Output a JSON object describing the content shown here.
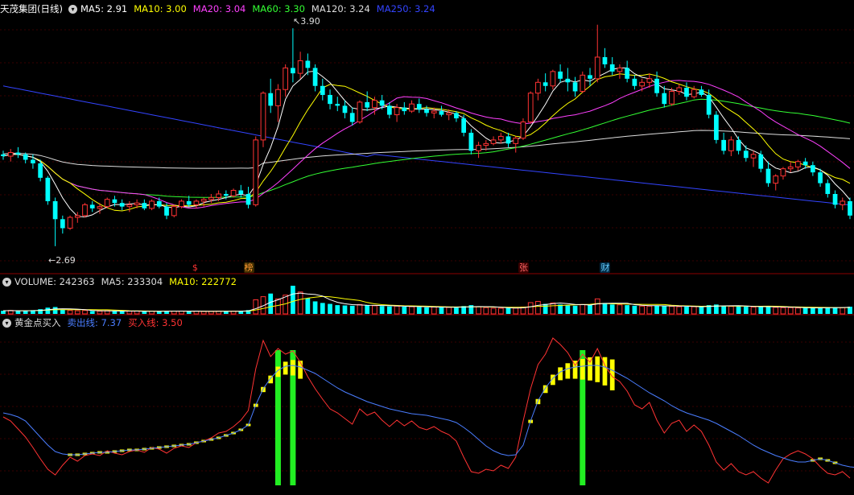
{
  "price_panel": {
    "stock_name": "天茂集团(日线)",
    "legend": [
      {
        "label": "MA5: 2.91",
        "color": "#ffffff"
      },
      {
        "label": "MA10: 3.00",
        "color": "#ffff00"
      },
      {
        "label": "MA20: 3.04",
        "color": "#ff40ff"
      },
      {
        "label": "MA60: 3.30",
        "color": "#33ff33"
      },
      {
        "label": "MA120: 3.24",
        "color": "#dddddd"
      },
      {
        "label": "MA250: 3.24",
        "color": "#3344ff"
      }
    ],
    "high_label": "3.90",
    "low_label": "2.69",
    "event_badges": [
      {
        "text": "$",
        "color": "#ff3333",
        "bg": "#000000"
      },
      {
        "text": "榜",
        "color": "#ff9933",
        "bg": "#3a2a00"
      },
      {
        "text": "张",
        "color": "#ff6666",
        "bg": "#3a0000"
      },
      {
        "text": "财",
        "color": "#66ccff",
        "bg": "#002a44"
      }
    ]
  },
  "volume_panel": {
    "legend": [
      {
        "label": "VOLUME: 242363",
        "color": "#dddddd"
      },
      {
        "label": "MA5: 233304",
        "color": "#dddddd"
      },
      {
        "label": "MA10: 222772",
        "color": "#ffff00"
      }
    ]
  },
  "indicator_panel": {
    "legend": [
      {
        "label": "黄金点买入",
        "color": "#dddddd"
      },
      {
        "label": "卖出线: 7.37",
        "color": "#4a7dff"
      },
      {
        "label": "买入线: 3.50",
        "color": "#ff3333"
      }
    ]
  },
  "chart_data": {
    "type": "candlestick",
    "price_range": [
      2.6,
      3.95
    ],
    "colors": {
      "up": "#ff3333",
      "down": "#00ffff",
      "ma5": "#ffffff",
      "ma10": "#ffff00",
      "ma20": "#ff40ff",
      "ma60": "#33ff33",
      "ma120": "#dddddd",
      "ma250": "#3344ff",
      "sell_line": "#4a7dff",
      "buy_line": "#ff3333",
      "yellow_bar": "#ffff00",
      "green_signal": "#22ee22"
    },
    "candles": [
      [
        3.2,
        3.22,
        3.17,
        3.19
      ],
      [
        3.19,
        3.23,
        3.16,
        3.21
      ],
      [
        3.21,
        3.24,
        3.18,
        3.2
      ],
      [
        3.2,
        3.21,
        3.15,
        3.17
      ],
      [
        3.17,
        3.2,
        3.12,
        3.15
      ],
      [
        3.15,
        3.17,
        3.05,
        3.07
      ],
      [
        3.07,
        3.08,
        2.92,
        2.94
      ],
      [
        2.94,
        2.96,
        2.69,
        2.84
      ],
      [
        2.84,
        2.86,
        2.76,
        2.79
      ],
      [
        2.79,
        2.86,
        2.78,
        2.85
      ],
      [
        2.85,
        2.88,
        2.82,
        2.86
      ],
      [
        2.86,
        2.93,
        2.85,
        2.92
      ],
      [
        2.92,
        2.94,
        2.88,
        2.9
      ],
      [
        2.9,
        2.93,
        2.87,
        2.91
      ],
      [
        2.91,
        2.96,
        2.9,
        2.95
      ],
      [
        2.95,
        2.97,
        2.91,
        2.93
      ],
      [
        2.93,
        2.95,
        2.89,
        2.91
      ],
      [
        2.91,
        2.94,
        2.88,
        2.92
      ],
      [
        2.92,
        2.95,
        2.9,
        2.93
      ],
      [
        2.93,
        2.95,
        2.89,
        2.9
      ],
      [
        2.9,
        2.95,
        2.89,
        2.94
      ],
      [
        2.94,
        2.96,
        2.9,
        2.91
      ],
      [
        2.91,
        2.93,
        2.84,
        2.86
      ],
      [
        2.86,
        2.92,
        2.85,
        2.91
      ],
      [
        2.91,
        2.95,
        2.9,
        2.94
      ],
      [
        2.94,
        2.97,
        2.91,
        2.92
      ],
      [
        2.92,
        2.95,
        2.9,
        2.94
      ],
      [
        2.94,
        2.96,
        2.91,
        2.95
      ],
      [
        2.95,
        2.98,
        2.93,
        2.96
      ],
      [
        2.96,
        3.0,
        2.94,
        2.98
      ],
      [
        2.98,
        3.0,
        2.95,
        2.97
      ],
      [
        2.97,
        3.01,
        2.96,
        3.0
      ],
      [
        3.0,
        3.03,
        2.96,
        2.98
      ],
      [
        2.98,
        3.02,
        2.9,
        2.92
      ],
      [
        2.92,
        3.3,
        2.91,
        3.28
      ],
      [
        3.28,
        3.55,
        3.24,
        3.54
      ],
      [
        3.54,
        3.62,
        3.43,
        3.47
      ],
      [
        3.47,
        3.59,
        3.38,
        3.56
      ],
      [
        3.56,
        3.7,
        3.52,
        3.68
      ],
      [
        3.68,
        3.9,
        3.6,
        3.65
      ],
      [
        3.65,
        3.77,
        3.62,
        3.72
      ],
      [
        3.72,
        3.76,
        3.64,
        3.68
      ],
      [
        3.68,
        3.7,
        3.55,
        3.58
      ],
      [
        3.58,
        3.62,
        3.5,
        3.53
      ],
      [
        3.53,
        3.56,
        3.45,
        3.48
      ],
      [
        3.48,
        3.52,
        3.44,
        3.47
      ],
      [
        3.47,
        3.5,
        3.4,
        3.43
      ],
      [
        3.43,
        3.46,
        3.36,
        3.38
      ],
      [
        3.38,
        3.5,
        3.37,
        3.49
      ],
      [
        3.49,
        3.55,
        3.44,
        3.46
      ],
      [
        3.46,
        3.52,
        3.42,
        3.5
      ],
      [
        3.5,
        3.53,
        3.45,
        3.47
      ],
      [
        3.47,
        3.49,
        3.4,
        3.42
      ],
      [
        3.42,
        3.48,
        3.38,
        3.46
      ],
      [
        3.46,
        3.49,
        3.42,
        3.44
      ],
      [
        3.44,
        3.5,
        3.43,
        3.48
      ],
      [
        3.48,
        3.51,
        3.43,
        3.45
      ],
      [
        3.45,
        3.47,
        3.41,
        3.43
      ],
      [
        3.43,
        3.46,
        3.4,
        3.44
      ],
      [
        3.44,
        3.47,
        3.41,
        3.42
      ],
      [
        3.42,
        3.45,
        3.39,
        3.43
      ],
      [
        3.43,
        3.44,
        3.38,
        3.4
      ],
      [
        3.4,
        3.42,
        3.3,
        3.32
      ],
      [
        3.32,
        3.34,
        3.2,
        3.22
      ],
      [
        3.22,
        3.27,
        3.18,
        3.25
      ],
      [
        3.25,
        3.28,
        3.22,
        3.26
      ],
      [
        3.26,
        3.3,
        3.25,
        3.28
      ],
      [
        3.28,
        3.32,
        3.26,
        3.3
      ],
      [
        3.3,
        3.32,
        3.24,
        3.26
      ],
      [
        3.26,
        3.3,
        3.21,
        3.29
      ],
      [
        3.29,
        3.4,
        3.28,
        3.38
      ],
      [
        3.38,
        3.55,
        3.37,
        3.54
      ],
      [
        3.54,
        3.62,
        3.5,
        3.6
      ],
      [
        3.6,
        3.65,
        3.55,
        3.58
      ],
      [
        3.58,
        3.67,
        3.56,
        3.66
      ],
      [
        3.66,
        3.7,
        3.6,
        3.62
      ],
      [
        3.62,
        3.68,
        3.55,
        3.6
      ],
      [
        3.6,
        3.63,
        3.52,
        3.55
      ],
      [
        3.55,
        3.66,
        3.54,
        3.64
      ],
      [
        3.64,
        3.68,
        3.58,
        3.62
      ],
      [
        3.62,
        3.92,
        3.6,
        3.74
      ],
      [
        3.74,
        3.79,
        3.68,
        3.7
      ],
      [
        3.7,
        3.74,
        3.64,
        3.66
      ],
      [
        3.66,
        3.7,
        3.62,
        3.68
      ],
      [
        3.68,
        3.72,
        3.6,
        3.62
      ],
      [
        3.62,
        3.64,
        3.56,
        3.58
      ],
      [
        3.58,
        3.62,
        3.55,
        3.6
      ],
      [
        3.6,
        3.65,
        3.57,
        3.62
      ],
      [
        3.62,
        3.66,
        3.52,
        3.54
      ],
      [
        3.54,
        3.58,
        3.46,
        3.48
      ],
      [
        3.48,
        3.57,
        3.47,
        3.55
      ],
      [
        3.55,
        3.59,
        3.53,
        3.57
      ],
      [
        3.57,
        3.6,
        3.5,
        3.52
      ],
      [
        3.52,
        3.58,
        3.51,
        3.56
      ],
      [
        3.56,
        3.58,
        3.52,
        3.53
      ],
      [
        3.53,
        3.56,
        3.4,
        3.42
      ],
      [
        3.42,
        3.44,
        3.26,
        3.28
      ],
      [
        3.28,
        3.32,
        3.2,
        3.22
      ],
      [
        3.22,
        3.3,
        3.19,
        3.28
      ],
      [
        3.28,
        3.3,
        3.2,
        3.22
      ],
      [
        3.22,
        3.25,
        3.16,
        3.18
      ],
      [
        3.18,
        3.22,
        3.13,
        3.2
      ],
      [
        3.2,
        3.22,
        3.1,
        3.12
      ],
      [
        3.12,
        3.16,
        3.02,
        3.04
      ],
      [
        3.04,
        3.09,
        3.0,
        3.08
      ],
      [
        3.08,
        3.13,
        3.06,
        3.12
      ],
      [
        3.12,
        3.16,
        3.1,
        3.13
      ],
      [
        3.13,
        3.17,
        3.11,
        3.16
      ],
      [
        3.16,
        3.18,
        3.12,
        3.14
      ],
      [
        3.14,
        3.16,
        3.08,
        3.1
      ],
      [
        3.1,
        3.12,
        3.02,
        3.04
      ],
      [
        3.04,
        3.06,
        2.96,
        2.98
      ],
      [
        2.98,
        3.0,
        2.9,
        2.92
      ],
      [
        2.92,
        2.96,
        2.89,
        2.94
      ],
      [
        2.94,
        2.96,
        2.84,
        2.86
      ]
    ],
    "volume": [
      1.0,
      1.1,
      0.9,
      1.0,
      1.2,
      1.5,
      2.0,
      2.2,
      1.3,
      1.1,
      1.0,
      1.1,
      0.9,
      0.9,
      1.0,
      0.9,
      0.8,
      0.9,
      0.9,
      0.8,
      0.9,
      0.8,
      1.0,
      0.9,
      0.9,
      0.8,
      0.9,
      0.8,
      0.8,
      0.9,
      0.9,
      0.9,
      0.9,
      1.2,
      4.5,
      5.5,
      6.5,
      4.8,
      6.0,
      9.0,
      7.0,
      5.0,
      4.0,
      3.5,
      3.2,
      2.8,
      2.7,
      2.6,
      3.0,
      2.7,
      2.6,
      2.5,
      2.4,
      2.5,
      2.3,
      2.3,
      2.2,
      2.1,
      2.2,
      2.1,
      2.1,
      2.0,
      2.5,
      2.8,
      2.3,
      2.0,
      1.8,
      1.8,
      1.9,
      1.9,
      2.2,
      3.6,
      4.0,
      3.2,
      3.5,
      3.0,
      2.8,
      2.6,
      3.0,
      2.8,
      4.8,
      3.5,
      3.0,
      2.9,
      2.8,
      2.6,
      2.5,
      2.5,
      2.7,
      2.6,
      2.4,
      2.3,
      2.3,
      2.3,
      2.2,
      2.8,
      3.0,
      2.6,
      2.4,
      2.4,
      2.3,
      2.2,
      2.3,
      2.4,
      2.1,
      2.0,
      2.0,
      1.9,
      1.9,
      1.9,
      2.0,
      2.1,
      2.1,
      2.0,
      2.3
    ],
    "sell_line": [
      1.5,
      1.3,
      1.0,
      0.5,
      -0.5,
      -1.5,
      -2.5,
      -3.3,
      -3.6,
      -3.7,
      -3.7,
      -3.6,
      -3.5,
      -3.4,
      -3.4,
      -3.3,
      -3.2,
      -3.1,
      -3.1,
      -3.0,
      -2.9,
      -2.8,
      -2.7,
      -2.6,
      -2.5,
      -2.4,
      -2.2,
      -2.0,
      -1.8,
      -1.6,
      -1.3,
      -1.0,
      -0.6,
      0.0,
      2.5,
      4.5,
      5.8,
      6.8,
      7.3,
      7.4,
      7.2,
      6.8,
      6.4,
      5.8,
      5.2,
      4.6,
      4.1,
      3.7,
      3.3,
      2.9,
      2.6,
      2.3,
      2.0,
      1.8,
      1.6,
      1.4,
      1.3,
      1.2,
      1.0,
      0.8,
      0.6,
      0.3,
      -0.3,
      -1.0,
      -1.8,
      -2.6,
      -3.2,
      -3.6,
      -3.8,
      -3.7,
      -2.5,
      0.5,
      3.0,
      4.6,
      5.8,
      6.6,
      7.0,
      7.2,
      7.3,
      7.4,
      7.4,
      7.2,
      6.8,
      6.3,
      5.8,
      5.2,
      4.6,
      4.0,
      3.5,
      3.0,
      2.4,
      1.9,
      1.5,
      1.2,
      0.9,
      0.6,
      0.2,
      -0.3,
      -0.8,
      -1.3,
      -1.9,
      -2.5,
      -3.0,
      -3.4,
      -3.8,
      -4.1,
      -4.4,
      -4.6,
      -4.6,
      -4.4,
      -4.2,
      -4.4,
      -4.7,
      -5.0,
      -5.2,
      -5.3
    ],
    "buy_line": [
      1.0,
      0.5,
      -0.5,
      -1.5,
      -2.8,
      -4.2,
      -5.5,
      -6.2,
      -5.0,
      -4.0,
      -4.5,
      -3.8,
      -3.6,
      -3.8,
      -3.2,
      -3.5,
      -3.7,
      -3.3,
      -3.1,
      -3.4,
      -2.8,
      -3.0,
      -3.5,
      -2.9,
      -2.6,
      -2.8,
      -2.2,
      -2.0,
      -1.6,
      -1.0,
      -0.8,
      -0.2,
      0.6,
      1.8,
      7.0,
      10.5,
      8.5,
      9.5,
      8.8,
      9.2,
      7.8,
      6.0,
      4.5,
      3.2,
      2.0,
      1.5,
      0.8,
      0.1,
      2.0,
      1.2,
      1.6,
      0.6,
      -0.2,
      0.6,
      -0.1,
      0.5,
      -0.3,
      -0.6,
      -0.2,
      -0.8,
      -1.2,
      -2.0,
      -4.0,
      -5.8,
      -6.0,
      -5.5,
      -5.7,
      -5.0,
      -5.4,
      -4.0,
      0.5,
      4.5,
      7.5,
      8.8,
      10.8,
      10.0,
      9.0,
      7.4,
      8.8,
      7.8,
      9.5,
      7.4,
      6.0,
      5.4,
      4.2,
      2.5,
      2.0,
      2.8,
      0.6,
      -1.0,
      0.2,
      0.6,
      -0.8,
      0.0,
      -0.8,
      -2.5,
      -4.6,
      -5.6,
      -4.8,
      -5.8,
      -6.2,
      -5.8,
      -6.6,
      -7.2,
      -5.6,
      -4.2,
      -3.6,
      -3.2,
      -3.6,
      -4.2,
      -5.2,
      -6.0,
      -6.2,
      -5.8,
      -6.6
    ],
    "yellow_bars": [
      {
        "from": 9,
        "to": 33,
        "kind": "flat"
      },
      {
        "from": 34,
        "to": 40,
        "kind": "bar"
      },
      {
        "from": 71,
        "to": 82,
        "kind": "bar"
      },
      {
        "from": 109,
        "to": 112,
        "kind": "flat"
      }
    ],
    "green_signals": [
      37,
      39,
      78
    ],
    "event_badge_positions": [
      26,
      33,
      70,
      81
    ]
  }
}
